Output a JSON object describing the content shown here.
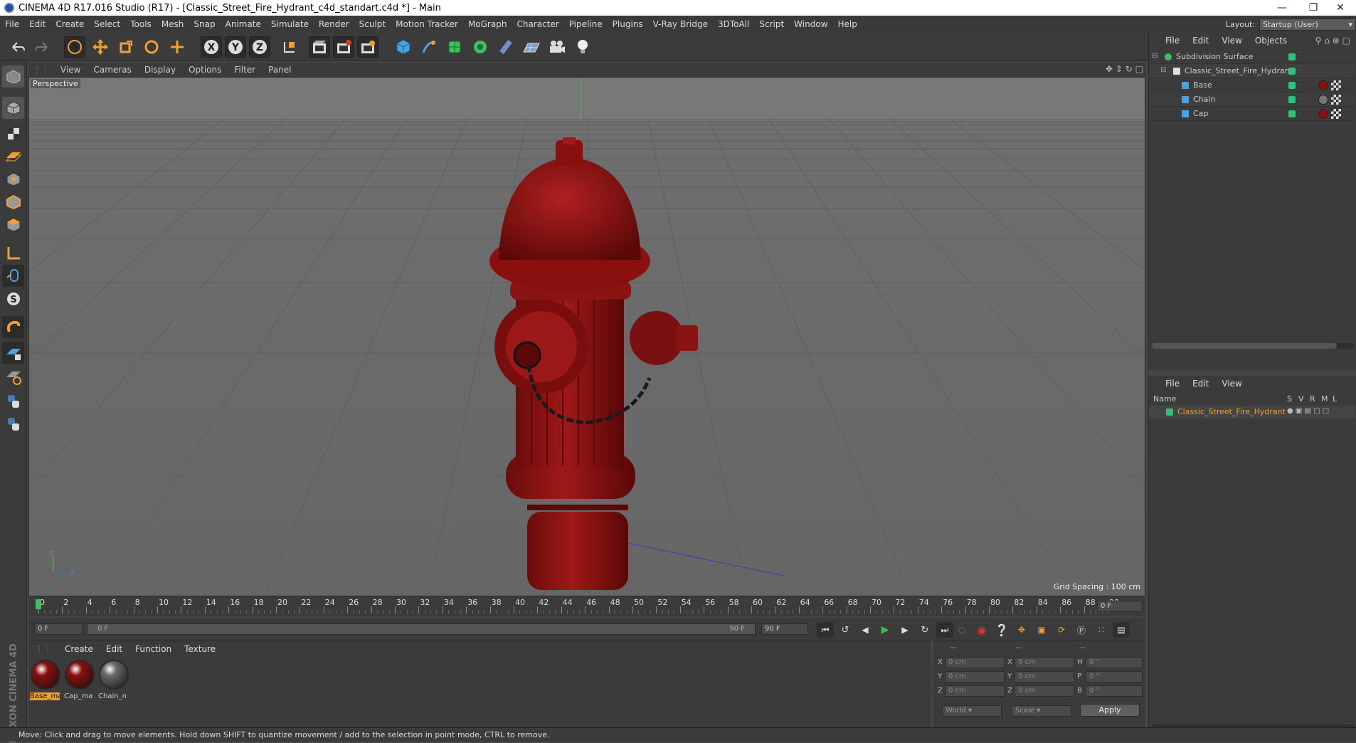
{
  "window": {
    "title": "CINEMA 4D R17.016 Studio (R17) - [Classic_Street_Fire_Hydrant_c4d_standart.c4d *] - Main",
    "controls": [
      "minimize-icon",
      "restore-icon",
      "close-icon"
    ]
  },
  "menu": [
    "File",
    "Edit",
    "Create",
    "Select",
    "Tools",
    "Mesh",
    "Snap",
    "Animate",
    "Simulate",
    "Render",
    "Sculpt",
    "Motion Tracker",
    "MoGraph",
    "Character",
    "Pipeline",
    "Plugins",
    "V-Ray Bridge",
    "3DToAll",
    "Script",
    "Window",
    "Help"
  ],
  "layout": {
    "label": "Layout:",
    "value": "Startup (User)"
  },
  "viewport": {
    "menus": [
      "View",
      "Cameras",
      "Display",
      "Options",
      "Filter",
      "Panel"
    ],
    "camera_label": "Perspective",
    "grid_spacing": "Grid Spacing : 100 cm",
    "axis_labels": [
      "Y",
      "X",
      "Z"
    ]
  },
  "timeline": {
    "ticks": [
      "0",
      "2",
      "4",
      "6",
      "8",
      "10",
      "12",
      "14",
      "16",
      "18",
      "20",
      "22",
      "24",
      "26",
      "28",
      "30",
      "32",
      "34",
      "36",
      "38",
      "40",
      "42",
      "44",
      "46",
      "48",
      "50",
      "52",
      "54",
      "56",
      "58",
      "60",
      "62",
      "64",
      "66",
      "68",
      "70",
      "72",
      "74",
      "76",
      "78",
      "80",
      "82",
      "84",
      "86",
      "88",
      "90"
    ],
    "current_frame": "0 F"
  },
  "transport": {
    "start_field": "0 F",
    "range_start": "0 F",
    "range_end": "90 F",
    "end_field": "90 F"
  },
  "material_manager": {
    "menus": [
      "Create",
      "Edit",
      "Function",
      "Texture"
    ],
    "materials": [
      {
        "name": "Base_ma",
        "color": "#8a1010",
        "selected": true
      },
      {
        "name": "Cap_ma",
        "color": "#8a1010",
        "selected": false
      },
      {
        "name": "Chain_n",
        "color": "#6a6a6a",
        "selected": false
      }
    ],
    "brand": "MAXON CINEMA 4D"
  },
  "coordinates": {
    "headers": [
      "--",
      "--",
      "--"
    ],
    "rows": [
      {
        "a": "X",
        "av": "0 cm",
        "b": "X",
        "bv": "0 cm",
        "c": "H",
        "cv": "0 °"
      },
      {
        "a": "Y",
        "av": "0 cm",
        "b": "Y",
        "bv": "0 cm",
        "c": "P",
        "cv": "0 °"
      },
      {
        "a": "Z",
        "av": "0 cm",
        "b": "Z",
        "bv": "0 cm",
        "c": "B",
        "cv": "0 °"
      }
    ],
    "mode1": "World",
    "mode2": "Scale",
    "apply": "Apply"
  },
  "object_manager": {
    "menus": [
      "File",
      "Edit",
      "View",
      "Objects"
    ],
    "objects": [
      {
        "name": "Subdivision Surface",
        "indent": 0
      },
      {
        "name": "Classic_Street_Fire_Hydrant",
        "indent": 1
      },
      {
        "name": "Base",
        "indent": 2
      },
      {
        "name": "Chain",
        "indent": 2
      },
      {
        "name": "Cap",
        "indent": 2
      }
    ]
  },
  "attribute_manager": {
    "menus": [
      "File",
      "Edit",
      "View"
    ],
    "columns": {
      "name": "Name",
      "s": "S",
      "v": "V",
      "r": "R",
      "m": "M",
      "l": "L"
    },
    "layer_name": "Classic_Street_Fire_Hydrant"
  },
  "status": "Move: Click and drag to move elements. Hold down SHIFT to quantize movement / add to the selection in point mode, CTRL to remove.",
  "colors": {
    "accent": "#f0a030",
    "hydrant": "#8b1a1a",
    "green": "#2ec27e"
  }
}
